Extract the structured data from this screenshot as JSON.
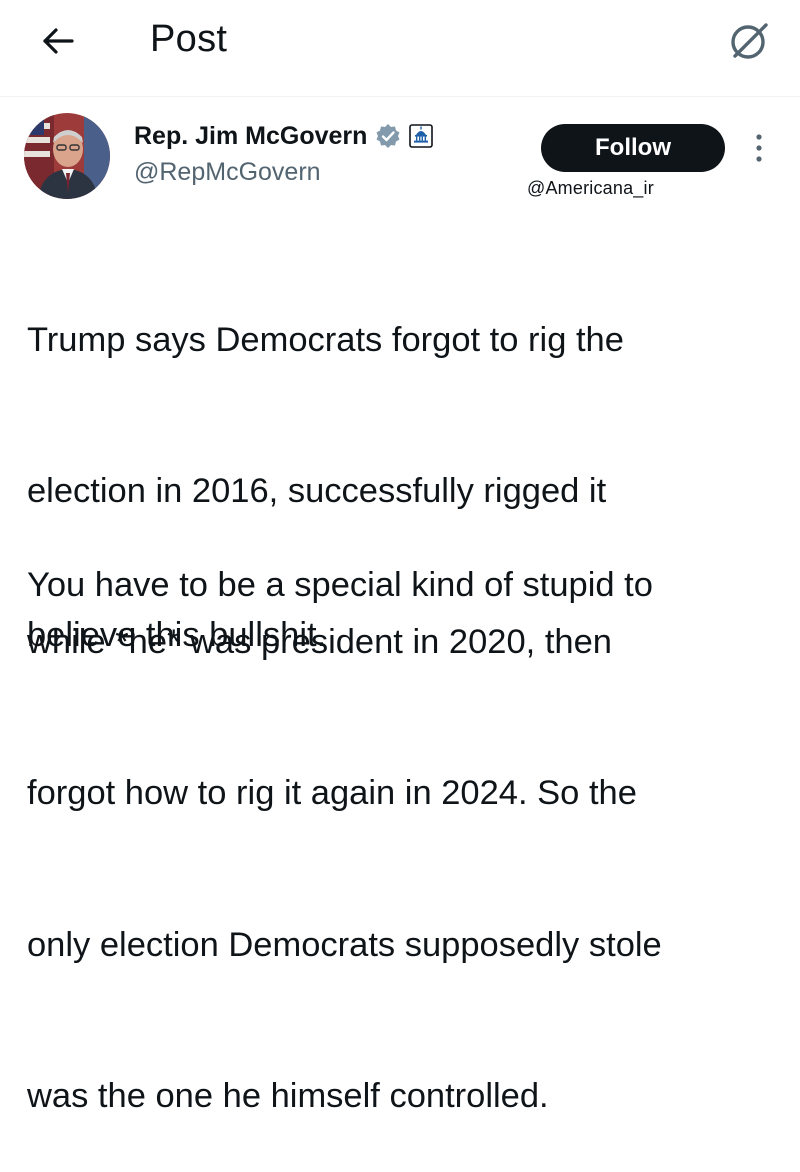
{
  "header": {
    "back_icon": "arrow-left-icon",
    "title": "Post",
    "grok_icon": "grok-slash-circle-icon"
  },
  "post": {
    "author_name": "Rep. Jim McGovern",
    "author_handle": "@RepMcGovern",
    "verified_color": "#829aab",
    "follow_label": "Follow",
    "watermark": "@Americana_ir",
    "text_lines": [
      "Trump says Democrats forgot to rig the",
      "election in 2016, successfully rigged it",
      "while *he* was president in 2020, then",
      "forgot how to rig it again in 2024. So the",
      "only election Democrats supposedly stole",
      "was the one he himself controlled."
    ],
    "text_lines_2": [
      "You have to be a special kind of stupid to",
      "believe this bullshit."
    ]
  },
  "colors": {
    "text": "#0f1419",
    "secondary": "#536471",
    "follow_bg": "#0f1419"
  }
}
